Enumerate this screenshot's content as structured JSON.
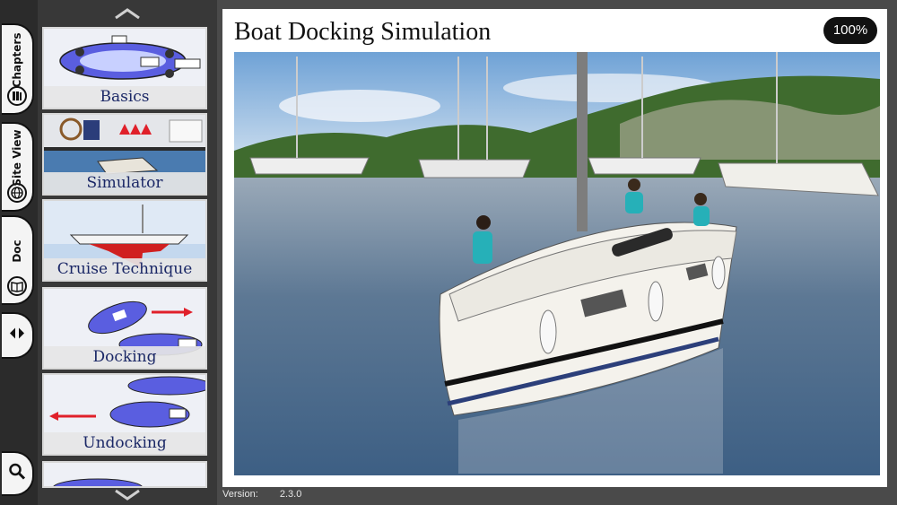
{
  "sidebar": {
    "tabs": [
      {
        "label": "Chapters",
        "icon": "books-icon"
      },
      {
        "label": "Site View",
        "icon": "globe-icon"
      },
      {
        "label": "Doc",
        "icon": "book-icon"
      }
    ],
    "nav_toggle_icon": "left-right-arrows-icon",
    "search_icon": "search-icon"
  },
  "chapters": {
    "items": [
      {
        "label": "Basics"
      },
      {
        "label": "Simulator"
      },
      {
        "label": "Cruise Technique"
      },
      {
        "label": "Docking"
      },
      {
        "label": "Undocking"
      }
    ],
    "scroll_up_icon": "chevron-up-icon",
    "scroll_down_icon": "chevron-down-icon"
  },
  "main": {
    "title": "Boat Docking Simulation",
    "zoom": "100%"
  },
  "footer": {
    "version_label": "Version:",
    "version_value": "2.3.0"
  },
  "colors": {
    "rail_bg": "#2b2b2b",
    "strip_bg": "#383838",
    "caption_text": "#1a2766",
    "boat_blue": "#5a5ee0",
    "arrow_red": "#e0202a"
  }
}
